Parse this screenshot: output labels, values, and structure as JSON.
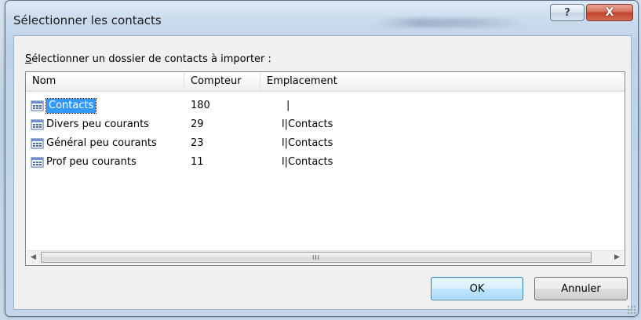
{
  "window": {
    "title": "Sélectionner les contacts",
    "help_label": "?",
    "close_label": "X"
  },
  "prompt": {
    "accel": "S",
    "rest": "électionner un dossier de contacts à importer :"
  },
  "list": {
    "columns": [
      "Nom",
      "Compteur",
      "Emplacement"
    ],
    "rows": [
      {
        "name": "Contacts",
        "count": "180",
        "location": "|",
        "selected": true
      },
      {
        "name": "Divers peu courants",
        "count": "29",
        "location": "l|Contacts",
        "selected": false
      },
      {
        "name": "Général peu courants",
        "count": "23",
        "location": "l|Contacts",
        "selected": false
      },
      {
        "name": "Prof peu courants",
        "count": "11",
        "location": "l|Contacts",
        "selected": false
      }
    ],
    "scroll_grip": "III"
  },
  "buttons": {
    "ok": "OK",
    "cancel": "Annuler"
  },
  "colors": {
    "selection": "#3399ff",
    "close_button": "#c2432a",
    "default_button_border": "#3c7fb1"
  }
}
